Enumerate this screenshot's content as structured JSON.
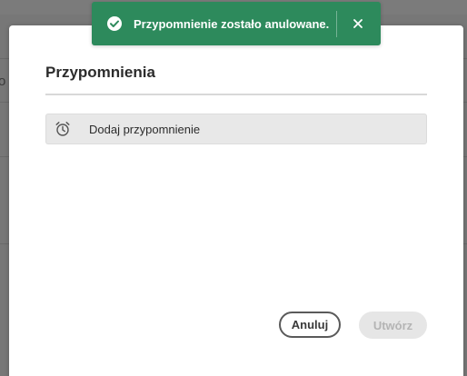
{
  "background": {
    "partial_text": "o"
  },
  "modal": {
    "title": "Przypomnienia",
    "add_reminder": {
      "label": "Dodaj przypomnienie",
      "icon": "alarm-clock-icon"
    },
    "buttons": {
      "cancel_label": "Anuluj",
      "create_label": "Utwórz",
      "create_disabled": true
    }
  },
  "toast": {
    "message": "Przypomnienie zostało anulowane.",
    "icon": "check-circle-icon",
    "close_icon": "close-icon",
    "color": "#2d8a5c"
  }
}
